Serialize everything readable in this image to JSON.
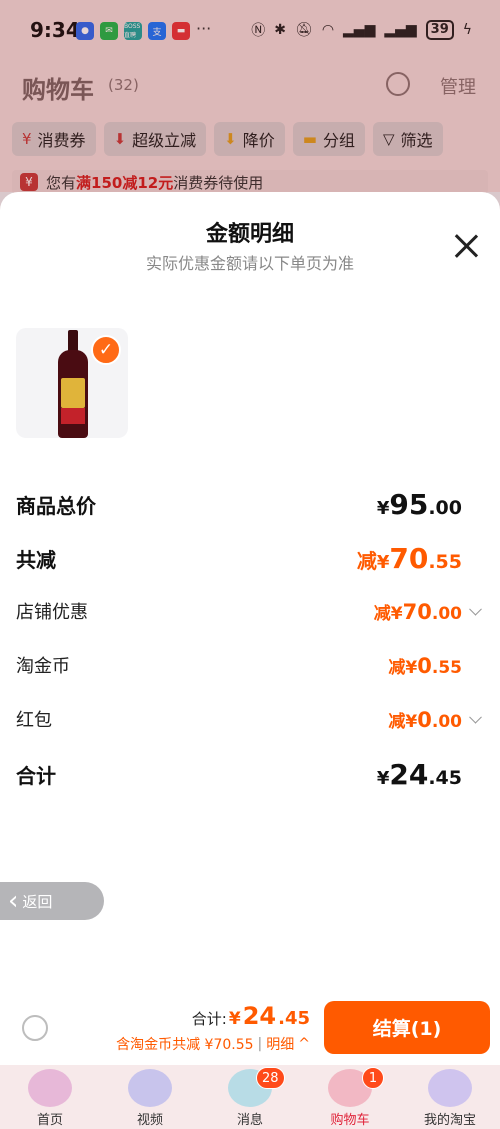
{
  "status_bar": {
    "time": "9:34",
    "battery": "39",
    "app_icons": [
      "app-icon-blue",
      "wechat-icon",
      "boss-icon",
      "alipay-icon",
      "red-app-icon"
    ],
    "boss_text": "BOSS直聘",
    "alipay_text": "支",
    "more": "···"
  },
  "cart": {
    "title": "购物车",
    "count": "(32)",
    "manage": "管理",
    "chips": [
      {
        "icon": "¥",
        "label": "消费券"
      },
      {
        "icon": "⬇",
        "label": "超级立减"
      },
      {
        "icon": "⬇",
        "label": "降价"
      },
      {
        "icon": "▬",
        "label": "分组"
      },
      {
        "icon": "▽",
        "label": "筛选"
      }
    ],
    "notice_prefix": "您有",
    "notice_highlight": "满150减12元",
    "notice_suffix": "消费券待使用",
    "notice_icon": "¥"
  },
  "sheet": {
    "title": "金额明细",
    "subtitle": "实际优惠金额请以下单页为准",
    "check": "✓",
    "rows": {
      "total": {
        "label": "商品总价",
        "yen": "¥",
        "int": "95",
        "dec": ".00"
      },
      "reduce": {
        "label": "共减",
        "pre": "减",
        "yen": "¥",
        "int": "70",
        "dec": ".55"
      },
      "shop": {
        "label": "店铺优惠",
        "pre": "减",
        "yen": "¥",
        "int": "70",
        "dec": ".00"
      },
      "coin": {
        "label": "淘金币",
        "pre": "减",
        "yen": "¥",
        "int": "0",
        "dec": ".55"
      },
      "redpacket": {
        "label": "红包",
        "pre": "减",
        "yen": "¥",
        "int": "0",
        "dec": ".00"
      },
      "sum": {
        "label": "合计",
        "yen": "¥",
        "int": "24",
        "dec": ".45"
      }
    },
    "back": "返回",
    "back_arrow": "‹"
  },
  "checkout": {
    "total_label": "合计:",
    "total_yen": "¥",
    "total_int": "24",
    "total_dec": ".45",
    "sub_text": "含淘金币共减 ¥70.55",
    "separator": "|",
    "detail": "明细",
    "detail_arrow": "^",
    "button": "结算(1)"
  },
  "tabbar": {
    "tabs": [
      {
        "label": "首页",
        "badge": ""
      },
      {
        "label": "视频",
        "badge": ""
      },
      {
        "label": "消息",
        "badge": "28"
      },
      {
        "label": "购物车",
        "badge": "1"
      },
      {
        "label": "我的淘宝",
        "badge": ""
      }
    ]
  }
}
